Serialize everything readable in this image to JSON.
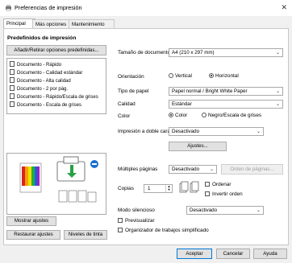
{
  "window": {
    "title": "Preferencias de impresión",
    "close_glyph": "✕"
  },
  "tabs": [
    "Principal",
    "Más opciones",
    "Mantenimiento"
  ],
  "presets": {
    "heading": "Predefinidos de impresión",
    "add_button": "Añadir/Retirar opciones predefinidas...",
    "items": [
      "Documento - Rápido",
      "Documento - Calidad estándar",
      "Documento - Alta calidad",
      "Documento - 2 por pág.",
      "Documento - Rápido/Escala de grises",
      "Documento - Escala de grises"
    ]
  },
  "left_buttons": {
    "show_settings": "Mostrar ajustes",
    "restore_defaults": "Restaurar ajustes",
    "ink_levels": "Niveles de tinta"
  },
  "form": {
    "doc_size_label": "Tamaño de documento",
    "doc_size_value": "A4 (210 x 297 mm)",
    "orientation_label": "Orientación",
    "orientation_vertical": "Vertical",
    "orientation_horizontal": "Horizontal",
    "paper_type_label": "Tipo de papel",
    "paper_type_value": "Papel normal / Bright White Paper",
    "quality_label": "Calidad",
    "quality_value": "Estándar",
    "color_label": "Color",
    "color_option": "Color",
    "grayscale_option": "Negro/Escala de grises",
    "duplex_label": "Impresión a doble cara",
    "duplex_value": "Desactivado",
    "settings_button": "Ajustes...",
    "multipage_label": "Múltiples páginas",
    "multipage_value": "Desactivado",
    "page_order_button": "Orden de páginas...",
    "copies_label": "Copias",
    "copies_value": "1",
    "collate_label": "Ordenar",
    "reverse_label": "Invertir orden",
    "quiet_mode_label": "Modo silencioso",
    "quiet_mode_value": "Desactivado",
    "preview_label": "Previsualizar",
    "simplified_organizer_label": "Organizador de trabajos simplificado"
  },
  "footer": {
    "ok": "Aceptar",
    "cancel": "Cancelar",
    "help": "Ayuda"
  }
}
